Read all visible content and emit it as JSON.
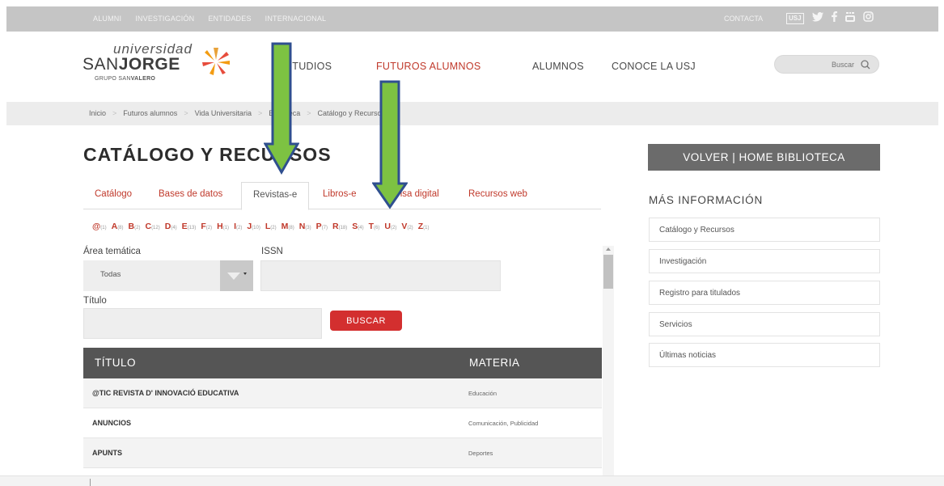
{
  "topbar": {
    "links": [
      "ALUMNI",
      "INVESTIGACIÓN",
      "ENTIDADES",
      "INTERNACIONAL"
    ],
    "contact": "CONTACTA",
    "social_icons": [
      "usj-tv-icon",
      "twitter-icon",
      "facebook-icon",
      "youtube-icon",
      "instagram-icon"
    ],
    "usj_badge": "USJ"
  },
  "logo": {
    "line1": "universidad",
    "line2_light": "SAN",
    "line2_bold": "JORGE",
    "line3_light": "GRUPO SAN",
    "line3_bold": "VALERO"
  },
  "nav": {
    "items": [
      "ESTUDIOS",
      "FUTUROS ALUMNOS",
      "ALUMNOS",
      "CONOCE LA USJ"
    ],
    "active_index": 1
  },
  "search": {
    "placeholder": "Buscar"
  },
  "breadcrumb": [
    "Inicio",
    "Futuros alumnos",
    "Vida Universitaria",
    "Biblioteca",
    "Catálogo y Recursos"
  ],
  "page": {
    "title": "CATÁLOGO Y RECURSOS"
  },
  "tabs": {
    "items": [
      "Catálogo",
      "Bases de datos",
      "Revistas-e",
      "Libros-e",
      "Prensa digital",
      "Recursos web"
    ],
    "active_index": 2
  },
  "alphabet": [
    {
      "letter": "@",
      "count": "(1)"
    },
    {
      "letter": "A",
      "count": "(8)"
    },
    {
      "letter": "B",
      "count": "(2)"
    },
    {
      "letter": "C",
      "count": "(12)"
    },
    {
      "letter": "D",
      "count": "(4)"
    },
    {
      "letter": "E",
      "count": "(13)"
    },
    {
      "letter": "F",
      "count": "(2)"
    },
    {
      "letter": "H",
      "count": "(1)"
    },
    {
      "letter": "I",
      "count": "(2)"
    },
    {
      "letter": "J",
      "count": "(10)"
    },
    {
      "letter": "L",
      "count": "(2)"
    },
    {
      "letter": "M",
      "count": "(8)"
    },
    {
      "letter": "N",
      "count": "(3)"
    },
    {
      "letter": "P",
      "count": "(7)"
    },
    {
      "letter": "R",
      "count": "(18)"
    },
    {
      "letter": "S",
      "count": "(4)"
    },
    {
      "letter": "T",
      "count": "(6)"
    },
    {
      "letter": "U",
      "count": "(2)"
    },
    {
      "letter": "V",
      "count": "(2)"
    },
    {
      "letter": "Z",
      "count": "(1)"
    }
  ],
  "form": {
    "area_label": "Área temática",
    "area_value": "Todas",
    "issn_label": "ISSN",
    "issn_value": "",
    "titulo_label": "Título",
    "titulo_value": "",
    "search_button": "BUSCAR"
  },
  "table": {
    "headers": [
      "TÍTULO",
      "MATERIA"
    ],
    "rows": [
      {
        "titulo": "@TIC REVISTA D' INNOVACIÓ EDUCATIVA",
        "materia": "Educación"
      },
      {
        "titulo": "ANUNCIOS",
        "materia": "Comunicación, Publicidad"
      },
      {
        "titulo": "APUNTS",
        "materia": "Deportes"
      }
    ]
  },
  "sidebar": {
    "back_button": "VOLVER | HOME BIBLIOTECA",
    "heading": "MÁS INFORMACIÓN",
    "links": [
      "Catálogo y Recursos",
      "Investigación",
      "Registro para titulados",
      "Servicios",
      "Últimas noticias"
    ]
  },
  "colors": {
    "accent_red": "#c0392b",
    "button_red": "#d32f2f",
    "arrow_green": "#7dc242",
    "arrow_border": "#2f4f8f",
    "table_header": "#555555"
  }
}
